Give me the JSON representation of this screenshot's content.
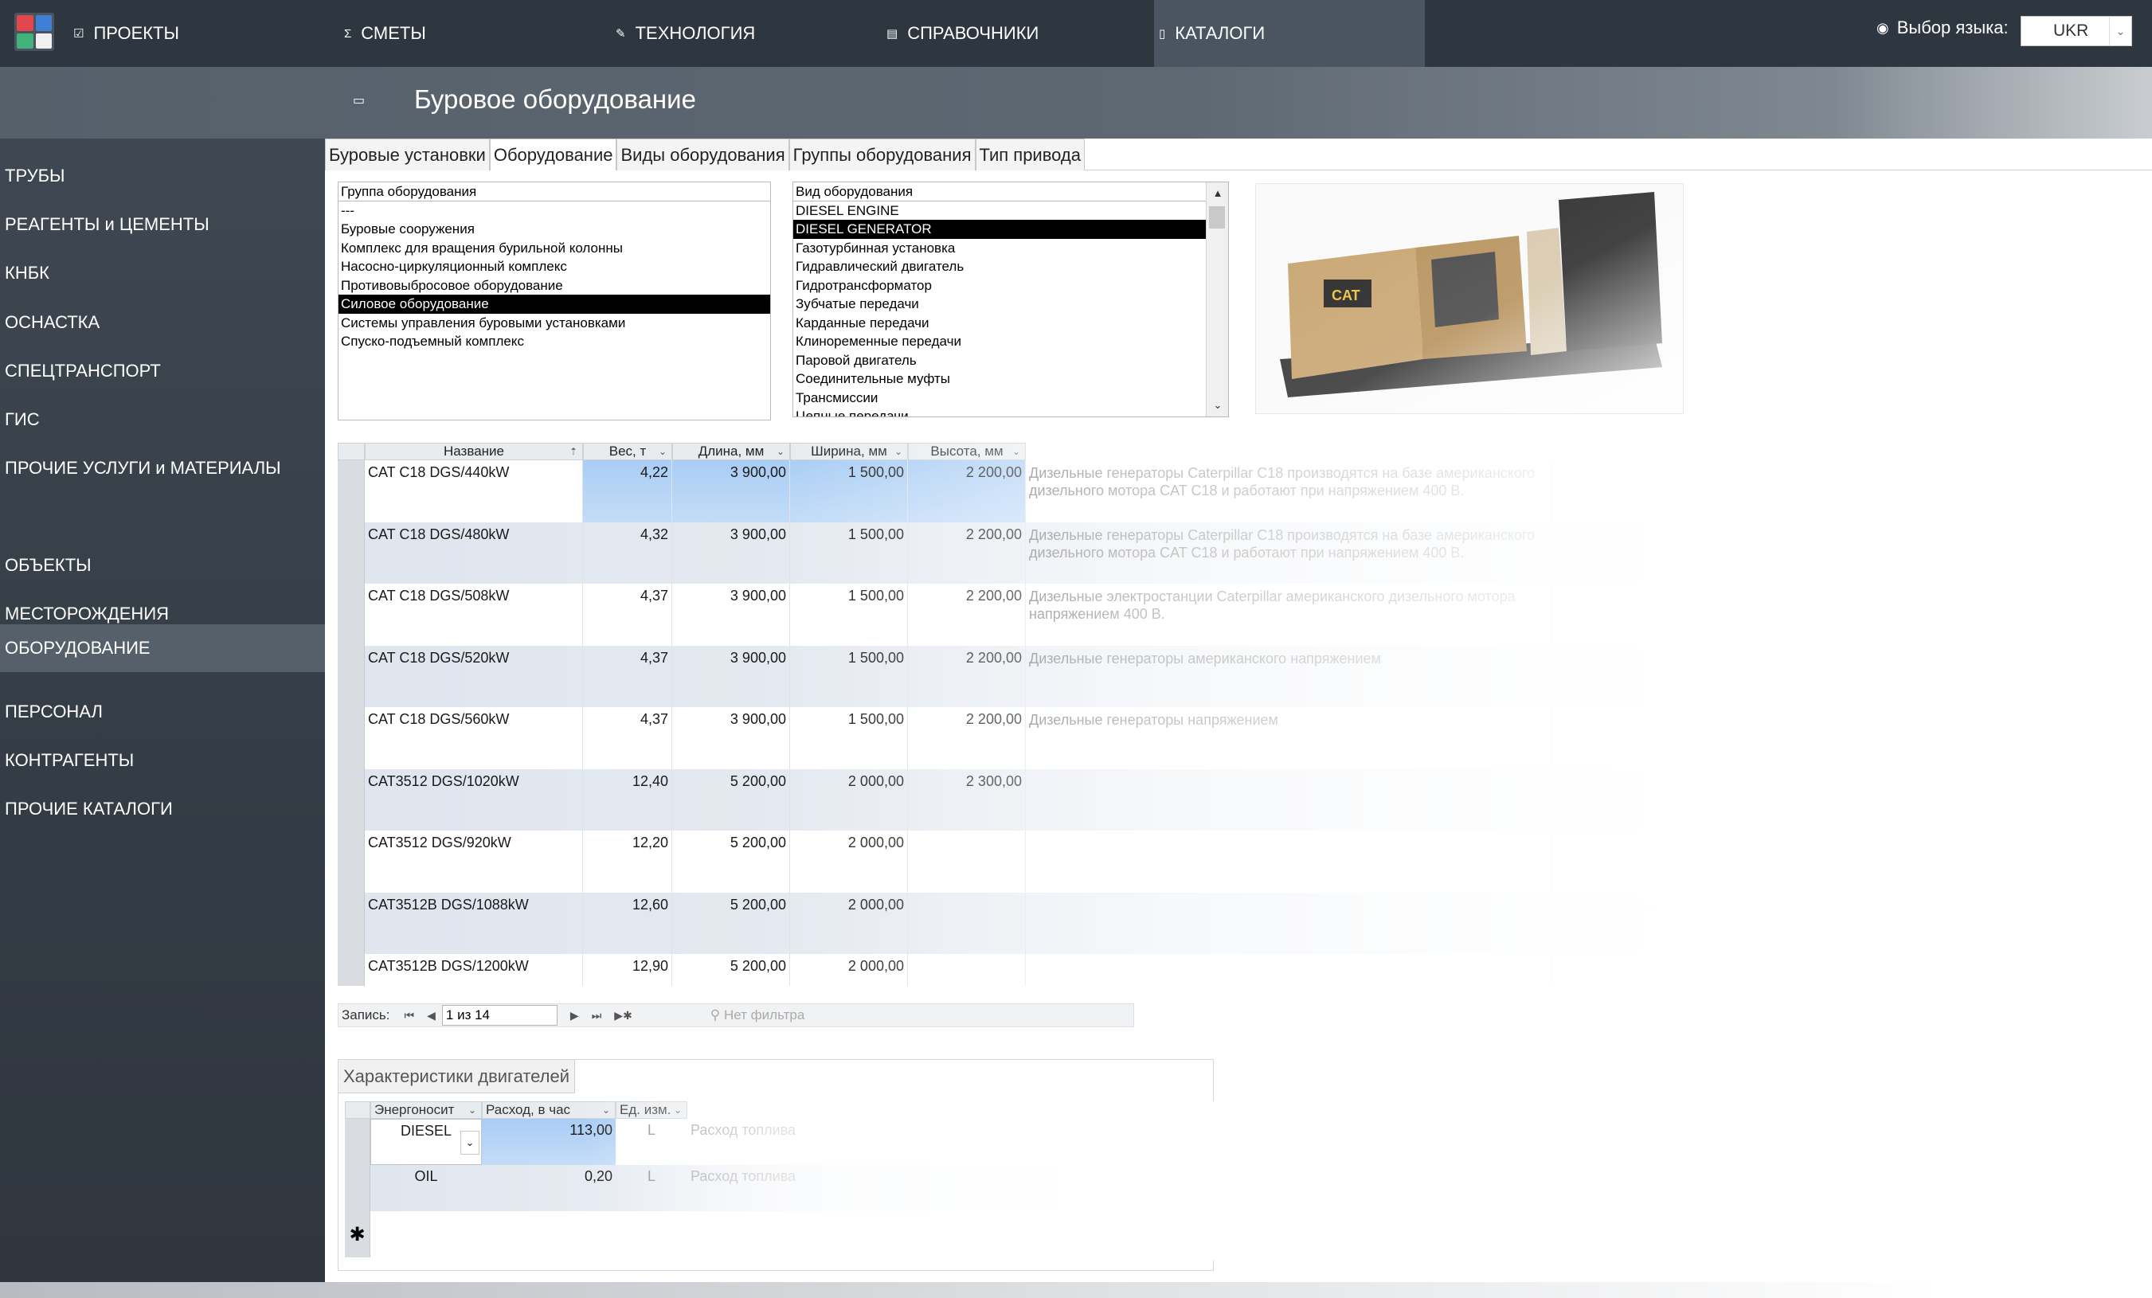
{
  "nav": {
    "tabs": [
      {
        "label": "ПРОЕКТЫ",
        "icon": "checkbox-icon"
      },
      {
        "label": "СМЕТЫ",
        "icon": "sigma-icon"
      },
      {
        "label": "ТЕХНОЛОГИЯ",
        "icon": "pencil-icon"
      },
      {
        "label": "СПРАВОЧНИКИ",
        "icon": "document-icon"
      },
      {
        "label": "КАТАЛОГИ",
        "icon": "catalog-icon"
      }
    ],
    "language_label": "Выбор языка:",
    "language_value": "UKR"
  },
  "header": {
    "title": "Буровое оборудование"
  },
  "sidebar": {
    "items": [
      "ТРУБЫ",
      "РЕАГЕНТЫ и ЦЕМЕНТЫ",
      "КНБК",
      "ОСНАСТКА",
      "СПЕЦТРАНСПОРТ",
      "ГИС",
      "ПРОЧИЕ УСЛУГИ и МАТЕРИАЛЫ",
      "ОБЪЕКТЫ",
      "МЕСТОРОЖДЕНИЯ",
      "ОБОРУДОВАНИЕ",
      "ПЕРСОНАЛ",
      "КОНТРАГЕНТЫ",
      "ПРОЧИЕ КАТАЛОГИ"
    ],
    "active": "ОБОРУДОВАНИЕ"
  },
  "tabs": [
    "Буровые установки",
    "Оборудование",
    "Виды оборудования",
    "Группы оборудования",
    "Тип привода"
  ],
  "group_list": {
    "header": "Группа оборудования",
    "items": [
      "---",
      "Буровые сооружения",
      "Комплекс для вращения бурильной колонны",
      "Насосно-циркуляционный комплекс",
      "Противовыбросовое оборудование",
      "Силовое оборудование",
      "Системы управления буровыми установками",
      "Спуско-подъемный комплекс"
    ],
    "selected": "Силовое оборудование"
  },
  "type_list": {
    "header": "Вид оборудования",
    "items": [
      "DIESEL ENGINE",
      "DIESEL GENERATOR",
      "Газотурбинная установка",
      "Гидравлический двигатель",
      "Гидротрансформатор",
      "Зубчатые передачи",
      "Карданные передачи",
      "Клиноременные передачи",
      "Паровой двигатель",
      "Соединительные муфты",
      "Трансмиссии",
      "Цепные передачи"
    ],
    "selected": "DIESEL GENERATOR"
  },
  "grid": {
    "columns": [
      "Название",
      "Вес, т",
      "Длина, мм",
      "Ширина, мм",
      "Высота, мм"
    ],
    "rows": [
      {
        "name": "CAT C18 DGS/440kW",
        "weight": "4,22",
        "length": "3 900,00",
        "width": "1 500,00",
        "height": "2 200,00",
        "desc": "Дизельные генераторы Caterpillar C18 производятся на базе американского дизельного мотора CAT C18 и работают при напряжением 400 В."
      },
      {
        "name": "CAT C18 DGS/480kW",
        "weight": "4,32",
        "length": "3 900,00",
        "width": "1 500,00",
        "height": "2 200,00",
        "desc": "Дизельные генераторы Caterpillar C18 производятся на базе американского дизельного мотора CAT C18 и работают при напряжением 400 В."
      },
      {
        "name": "CAT C18 DGS/508kW",
        "weight": "4,37",
        "length": "3 900,00",
        "width": "1 500,00",
        "height": "2 200,00",
        "desc": "Дизельные электростанции Caterpillar американского дизельного мотора напряжением 400 В."
      },
      {
        "name": "CAT C18 DGS/520kW",
        "weight": "4,37",
        "length": "3 900,00",
        "width": "1 500,00",
        "height": "2 200,00",
        "desc": "Дизельные генераторы американского напряжением"
      },
      {
        "name": "CAT C18 DGS/560kW",
        "weight": "4,37",
        "length": "3 900,00",
        "width": "1 500,00",
        "height": "2 200,00",
        "desc": "Дизельные генераторы напряжением"
      },
      {
        "name": "CAT3512 DGS/1020kW",
        "weight": "12,40",
        "length": "5 200,00",
        "width": "2 000,00",
        "height": "2 300,00",
        "desc": ""
      },
      {
        "name": "CAT3512 DGS/920kW",
        "weight": "12,20",
        "length": "5 200,00",
        "width": "2 000,00",
        "height": "",
        "desc": ""
      },
      {
        "name": "CAT3512B DGS/1088kW",
        "weight": "12,60",
        "length": "5 200,00",
        "width": "2 000,00",
        "height": "",
        "desc": ""
      },
      {
        "name": "CAT3512B DGS/1200kW",
        "weight": "12,90",
        "length": "5 200,00",
        "width": "2 000,00",
        "height": "",
        "desc": ""
      }
    ]
  },
  "pager": {
    "label": "Запись:",
    "value": "1 из 14",
    "filter": "Нет фильтра"
  },
  "characteristics": {
    "tab": "Характеристики двигателей",
    "columns": [
      "Энергоносит",
      "Расход, в час",
      "Ед. изм."
    ],
    "rows": [
      {
        "carrier": "DIESEL",
        "rate": "113,00",
        "unit": "L",
        "note": "Расход топлива"
      },
      {
        "carrier": "OIL",
        "rate": "0,20",
        "unit": "L",
        "note": "Расход топлива"
      }
    ],
    "new_row_marker": "✱"
  },
  "colors": {
    "nav_bg": "#2e3640",
    "sidebar_bg": "#3a424b",
    "selection": "#000000",
    "row_highlight": "#a9cdf5"
  }
}
